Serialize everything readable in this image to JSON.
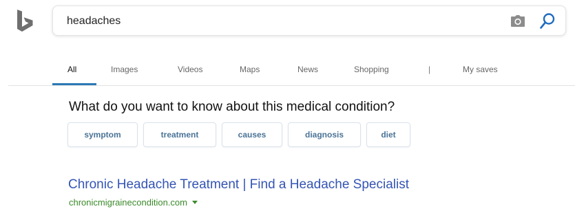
{
  "search": {
    "query": "headaches"
  },
  "icons": {
    "logo": "bing-logo-icon",
    "camera": "camera-icon",
    "search": "search-icon",
    "url_caret": "caret-down-icon"
  },
  "nav": {
    "tabs": [
      {
        "label": "All",
        "active": true
      },
      {
        "label": "Images"
      },
      {
        "label": "Videos"
      },
      {
        "label": "Maps"
      },
      {
        "label": "News"
      },
      {
        "label": "Shopping"
      }
    ],
    "separator": "|",
    "my_saves": "My saves"
  },
  "refine": {
    "question": "What do you want to know about this medical condition?",
    "chips": [
      "symptom",
      "treatment",
      "causes",
      "diagnosis",
      "diet"
    ]
  },
  "result": {
    "title": "Chronic Headache Treatment | Find a Headache Specialist",
    "url": "chronicmigrainecondition.com"
  },
  "colors": {
    "accent": "#2b78b5",
    "link": "#3454b4",
    "url_green": "#3b8a2a",
    "chip_text": "#4a7396"
  }
}
